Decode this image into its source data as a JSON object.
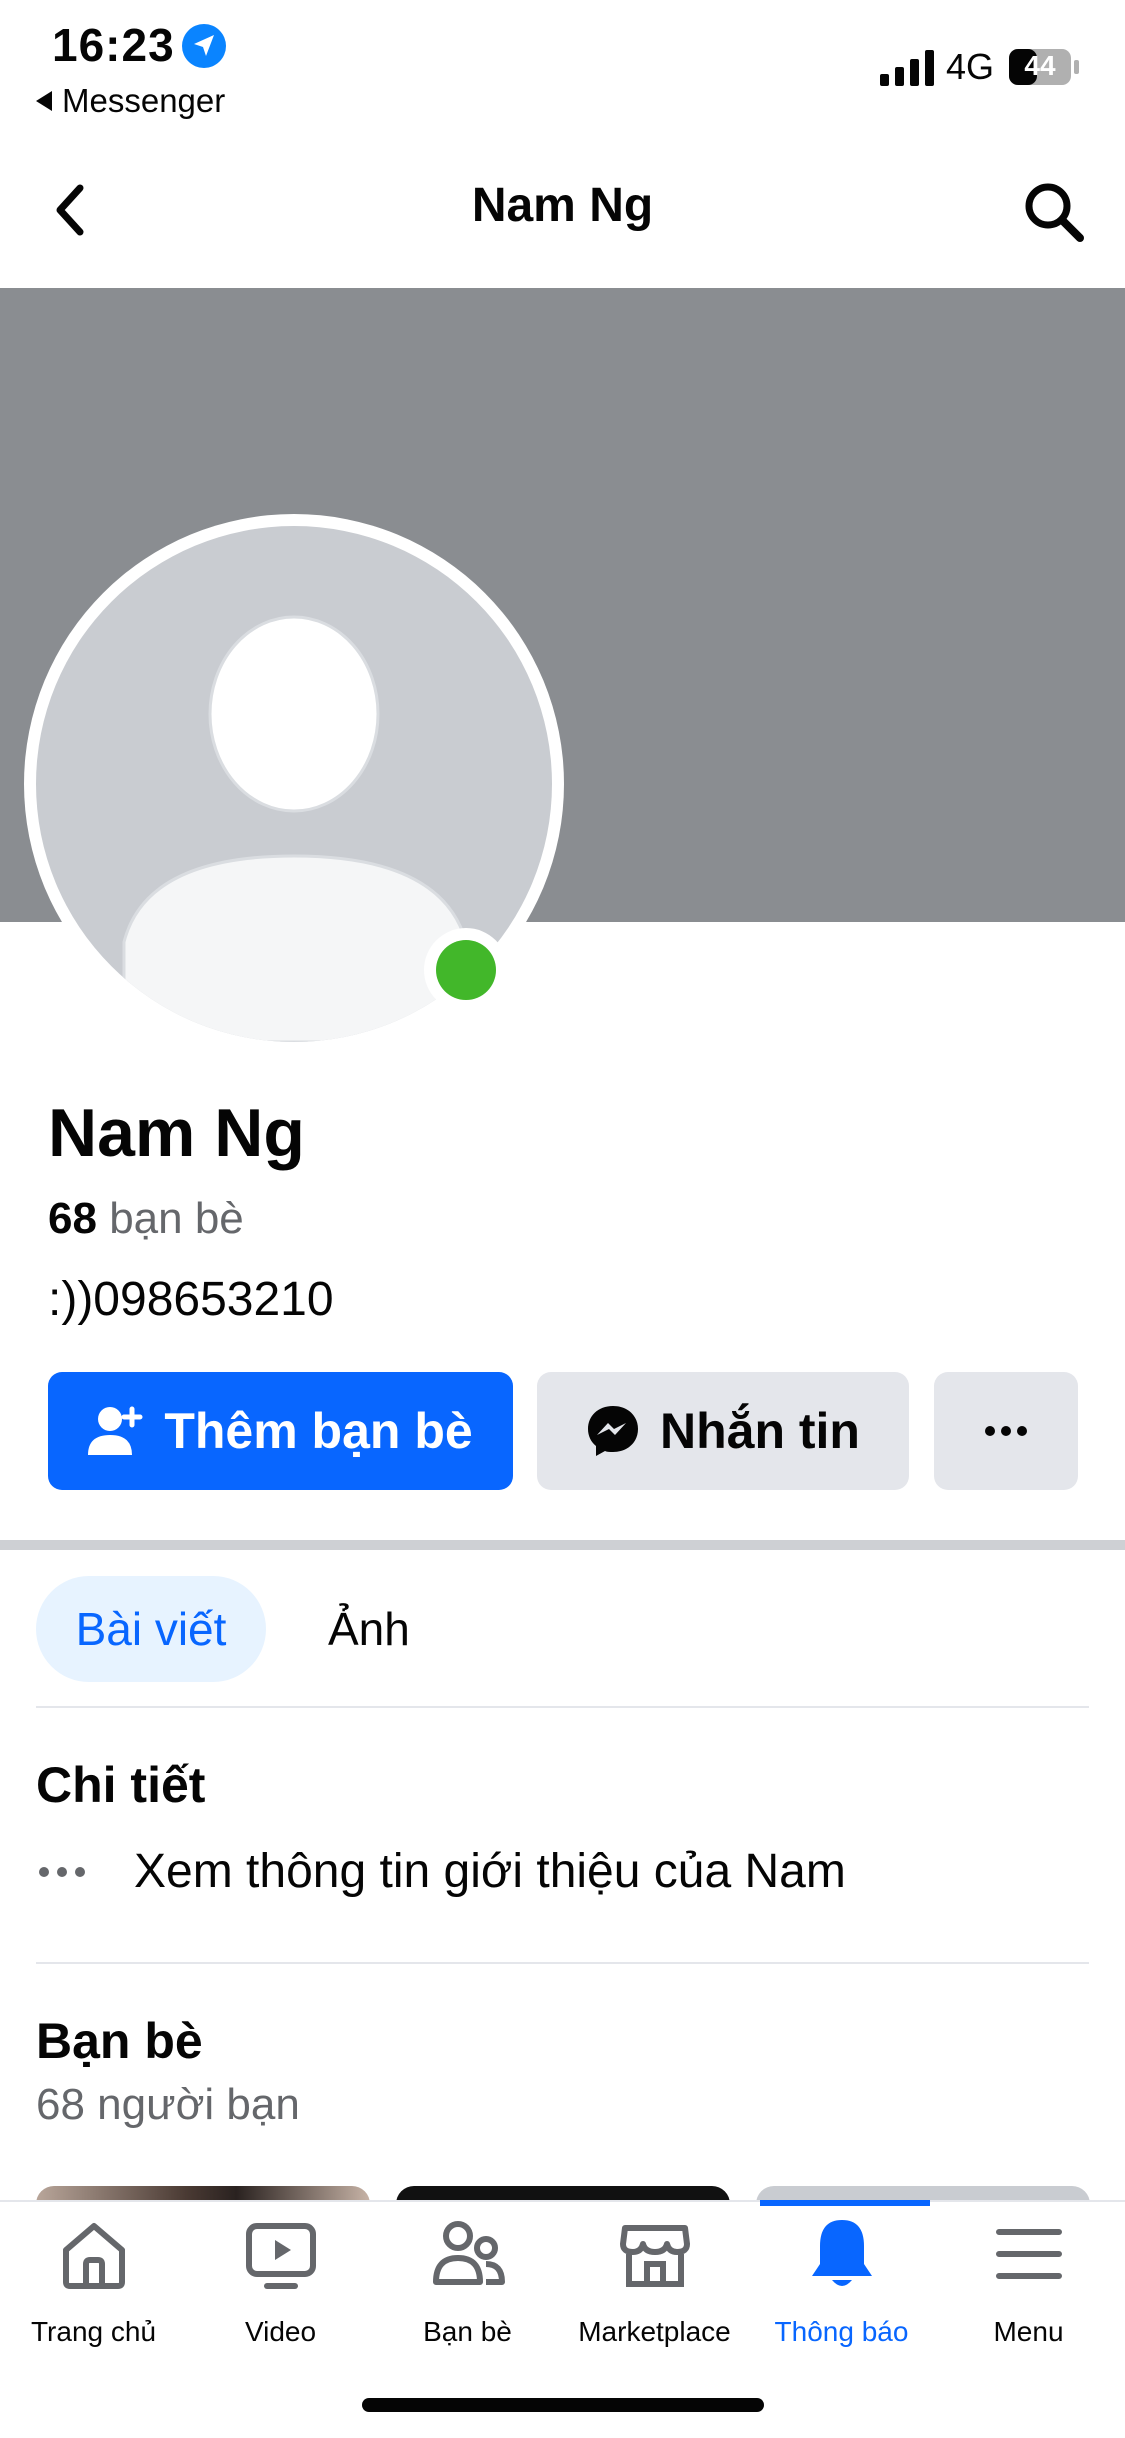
{
  "status_bar": {
    "time": "16:23",
    "back_app": "Messenger",
    "network": "4G",
    "battery": "44"
  },
  "header": {
    "title": "Nam Ng",
    "back_icon": "chevron-left-icon",
    "search_icon": "search-icon"
  },
  "profile": {
    "name": "Nam Ng",
    "friend_count": "68",
    "friend_label": "bạn bè",
    "bio": ":))098653210",
    "online": true
  },
  "actions": {
    "add_friend_label": "Thêm bạn bè",
    "message_label": "Nhắn tin",
    "more_icon": "more-horizontal-icon"
  },
  "tabs": [
    {
      "label": "Bài viết",
      "active": true
    },
    {
      "label": "Ảnh",
      "active": false
    }
  ],
  "details": {
    "title": "Chi tiết",
    "intro_link": "Xem thông tin giới thiệu của Nam"
  },
  "friends_section": {
    "title": "Bạn bè",
    "count_label": "68 người bạn"
  },
  "tabbar": {
    "items": [
      {
        "label": "Trang chủ",
        "icon": "home-icon",
        "active": false
      },
      {
        "label": "Video",
        "icon": "video-icon",
        "active": false
      },
      {
        "label": "Bạn bè",
        "icon": "friends-icon",
        "active": false
      },
      {
        "label": "Marketplace",
        "icon": "marketplace-icon",
        "active": false
      },
      {
        "label": "Thông báo",
        "icon": "bell-icon",
        "active": true
      },
      {
        "label": "Menu",
        "icon": "menu-icon",
        "active": false
      }
    ]
  },
  "colors": {
    "accent": "#0866ff",
    "cover": "#8a8d91",
    "online": "#42b72a",
    "secondary_button": "#e4e6eb"
  }
}
